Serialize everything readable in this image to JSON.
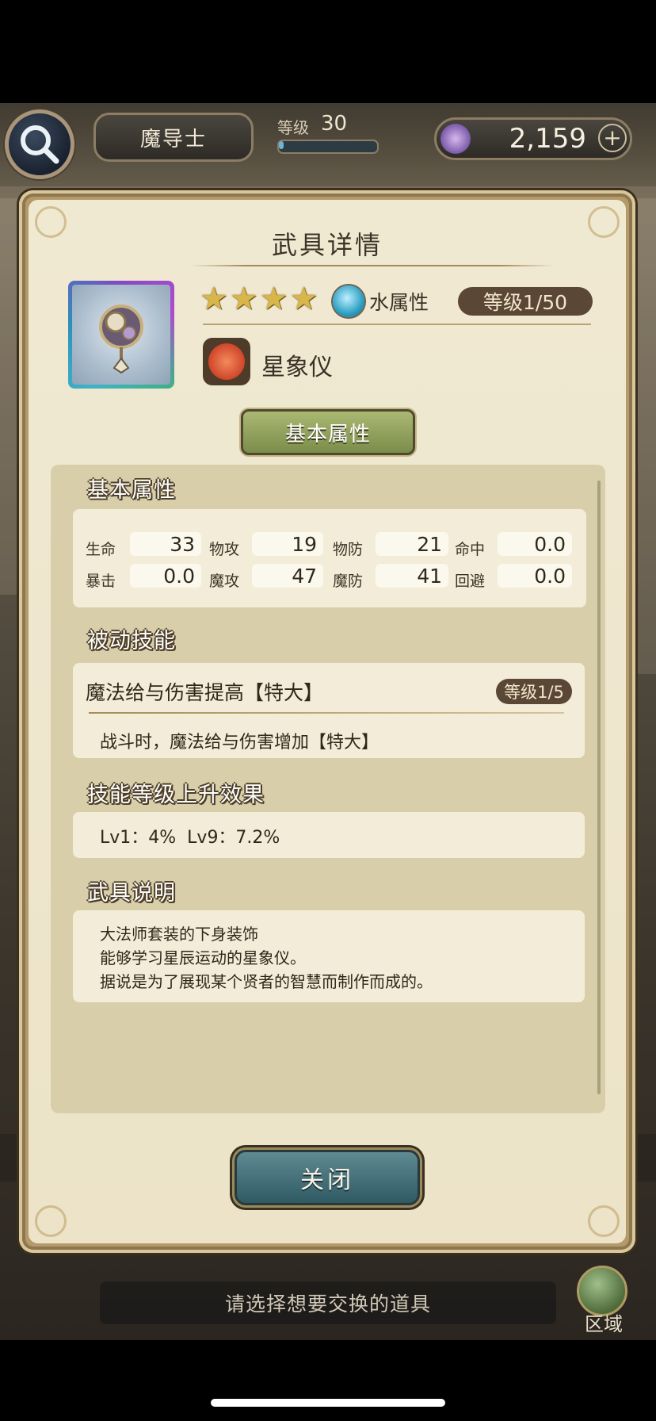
{
  "header": {
    "class_name": "魔导士",
    "level_label": "等级",
    "level_value": "30",
    "exp_progress": 0.05,
    "gem_count": "2,159",
    "plus_symbol": "+"
  },
  "dialog": {
    "title": "武具详情",
    "rarity_stars": [
      "★",
      "★",
      "★",
      "★"
    ],
    "element": "水属性",
    "level": "等级1/50",
    "item_name": "星象仪",
    "tab_label": "基本属性",
    "sections": {
      "base_stats_title": "基本属性",
      "stats": [
        {
          "label": "生命",
          "value": "33"
        },
        {
          "label": "物攻",
          "value": "19"
        },
        {
          "label": "物防",
          "value": "21"
        },
        {
          "label": "命中",
          "value": "0.0"
        },
        {
          "label": "暴击",
          "value": "0.0"
        },
        {
          "label": "魔攻",
          "value": "47"
        },
        {
          "label": "魔防",
          "value": "41"
        },
        {
          "label": "回避",
          "value": "0.0"
        }
      ],
      "passive_title": "被动技能",
      "passive_name": "魔法给与伤害提高【特大】",
      "passive_level": "等级1/5",
      "passive_desc": "战斗时，魔法给与伤害增加【特大】",
      "levelup_title": "技能等级上升效果",
      "levelup_text": "Lv1：4%  Lv9：7.2%",
      "desc_title": "武具说明",
      "desc_lines": [
        "大法师套装的下身装饰",
        "能够学习星辰运动的星象仪。",
        "据说是为了展现某个贤者的智慧而制作而成的。"
      ]
    },
    "close_label": "关闭"
  },
  "footer": {
    "hint": "请选择想要交换的道具",
    "region_label": "区域"
  },
  "colors": {
    "accent_brown": "#5a4735",
    "panel_bg": "#ece3c8",
    "tab_green": "#8fa05a",
    "close_teal": "#3f6b75"
  },
  "icons": [
    "search-icon",
    "gem-icon",
    "plus-icon",
    "star-icon",
    "water-element-icon",
    "weapon-item-icon",
    "item-type-icon",
    "region-globe-icon"
  ]
}
